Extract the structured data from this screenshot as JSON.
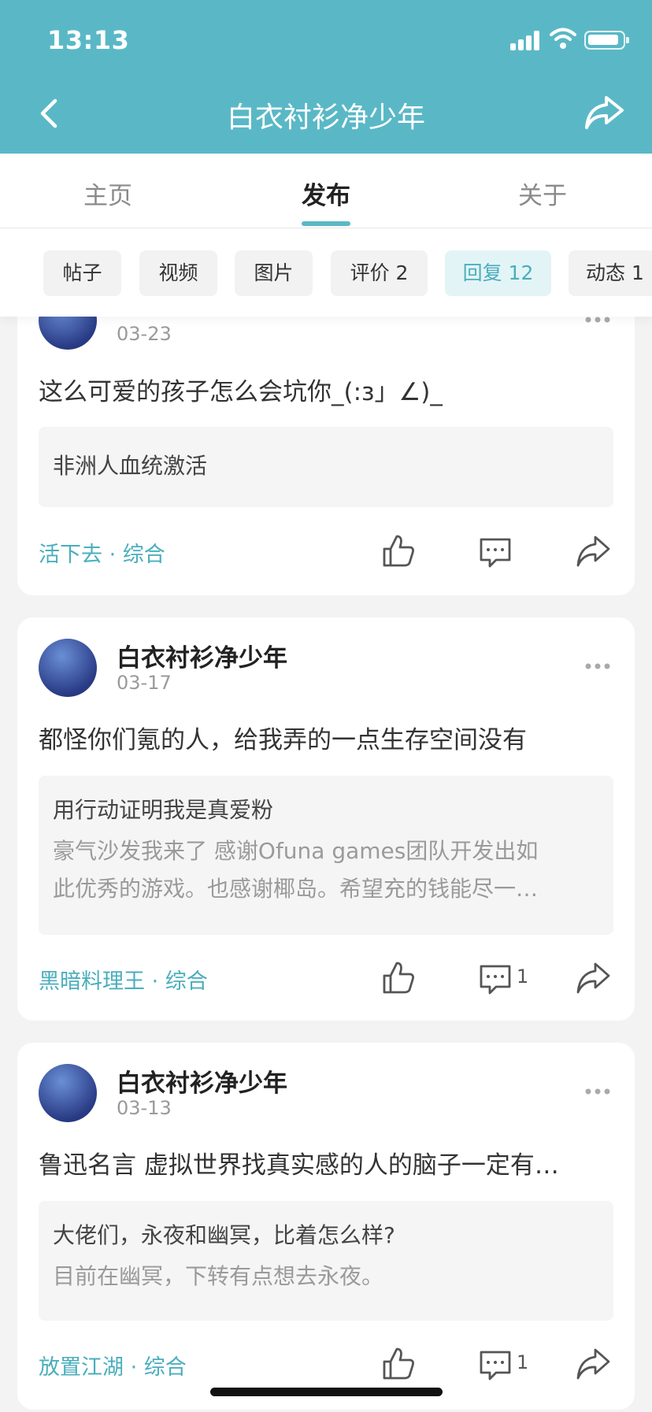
{
  "status_bar": {
    "time": "13:13"
  },
  "header": {
    "title": "白衣衬衫净少年"
  },
  "tabs": [
    {
      "label": "主页"
    },
    {
      "label": "发布"
    },
    {
      "label": "关于"
    }
  ],
  "filters": [
    {
      "label": "帖子"
    },
    {
      "label": "视频"
    },
    {
      "label": "图片"
    },
    {
      "label": "评价 2"
    },
    {
      "label": "回复 12"
    },
    {
      "label": "动态 1"
    }
  ],
  "posts": [
    {
      "date": "03-23",
      "text": "这么可爱的孩子怎么会坑你_(:з」∠)_",
      "quote_title": "非洲人血统激活",
      "source": "活下去 · 综合"
    },
    {
      "author": "白衣衬衫净少年",
      "date": "03-17",
      "text": "都怪你们氪的人，给我弄的一点生存空间没有",
      "quote_title": "用行动证明我是真爱粉",
      "quote_body_1": "豪气沙发我来了 感谢Ofuna games团队开发出如",
      "quote_body_2": "此优秀的游戏。也感谢椰岛。希望充的钱能尽一…",
      "source": "黑暗料理王 · 综合",
      "comment_count": "1"
    },
    {
      "author": "白衣衬衫净少年",
      "date": "03-13",
      "text": "鲁迅名言 虚拟世界找真实感的人的脑子一定有…",
      "quote_title": "大佬们，永夜和幽冥，比着怎么样?",
      "quote_body_1": "目前在幽冥，下转有点想去永夜。",
      "source": "放置江湖 · 综合",
      "comment_count": "1"
    }
  ],
  "colors": {
    "accent": "#5ab8c6",
    "link": "#4aaebd"
  }
}
